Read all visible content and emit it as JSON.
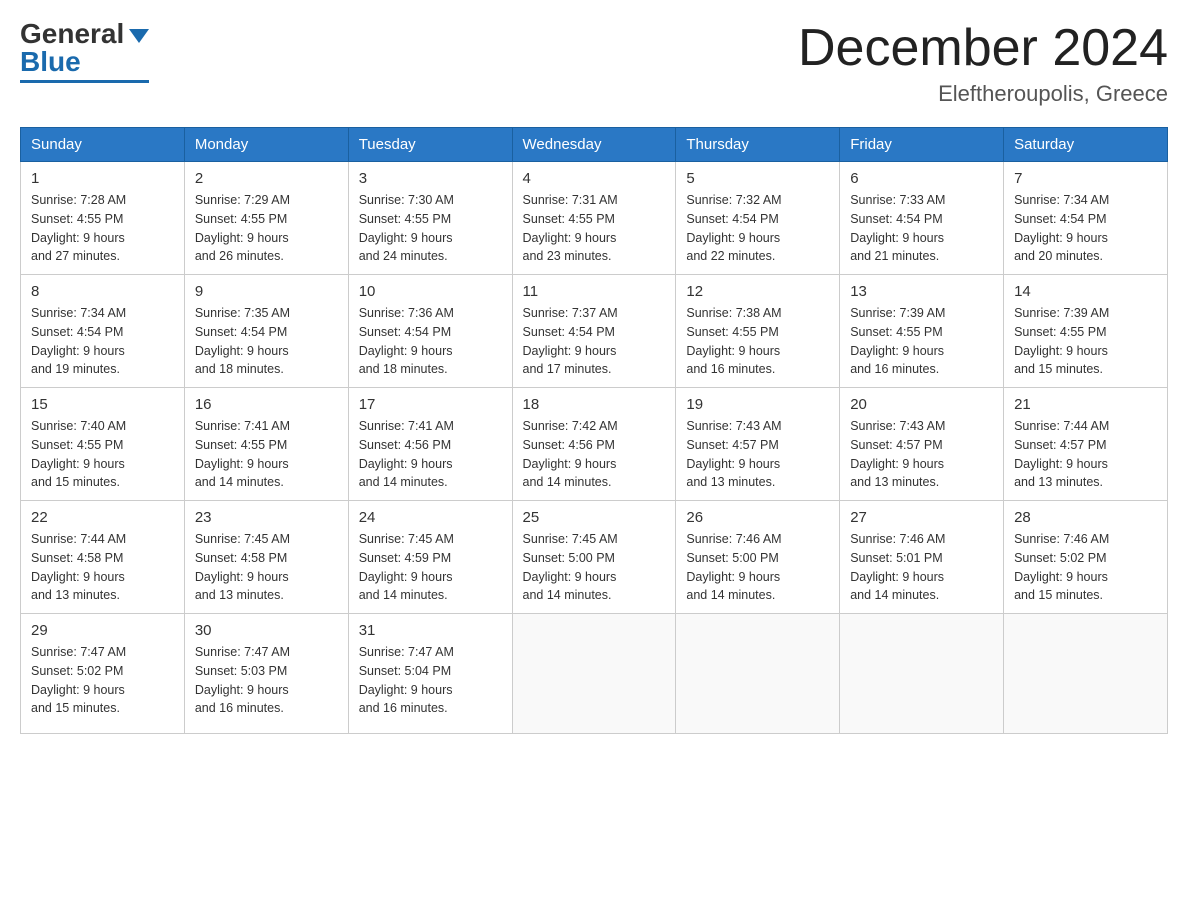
{
  "logo": {
    "general": "General",
    "blue": "Blue"
  },
  "title": "December 2024",
  "location": "Eleftheroupolis, Greece",
  "days_of_week": [
    "Sunday",
    "Monday",
    "Tuesday",
    "Wednesday",
    "Thursday",
    "Friday",
    "Saturday"
  ],
  "weeks": [
    [
      {
        "day": "1",
        "sunrise": "7:28 AM",
        "sunset": "4:55 PM",
        "daylight": "9 hours and 27 minutes."
      },
      {
        "day": "2",
        "sunrise": "7:29 AM",
        "sunset": "4:55 PM",
        "daylight": "9 hours and 26 minutes."
      },
      {
        "day": "3",
        "sunrise": "7:30 AM",
        "sunset": "4:55 PM",
        "daylight": "9 hours and 24 minutes."
      },
      {
        "day": "4",
        "sunrise": "7:31 AM",
        "sunset": "4:55 PM",
        "daylight": "9 hours and 23 minutes."
      },
      {
        "day": "5",
        "sunrise": "7:32 AM",
        "sunset": "4:54 PM",
        "daylight": "9 hours and 22 minutes."
      },
      {
        "day": "6",
        "sunrise": "7:33 AM",
        "sunset": "4:54 PM",
        "daylight": "9 hours and 21 minutes."
      },
      {
        "day": "7",
        "sunrise": "7:34 AM",
        "sunset": "4:54 PM",
        "daylight": "9 hours and 20 minutes."
      }
    ],
    [
      {
        "day": "8",
        "sunrise": "7:34 AM",
        "sunset": "4:54 PM",
        "daylight": "9 hours and 19 minutes."
      },
      {
        "day": "9",
        "sunrise": "7:35 AM",
        "sunset": "4:54 PM",
        "daylight": "9 hours and 18 minutes."
      },
      {
        "day": "10",
        "sunrise": "7:36 AM",
        "sunset": "4:54 PM",
        "daylight": "9 hours and 18 minutes."
      },
      {
        "day": "11",
        "sunrise": "7:37 AM",
        "sunset": "4:54 PM",
        "daylight": "9 hours and 17 minutes."
      },
      {
        "day": "12",
        "sunrise": "7:38 AM",
        "sunset": "4:55 PM",
        "daylight": "9 hours and 16 minutes."
      },
      {
        "day": "13",
        "sunrise": "7:39 AM",
        "sunset": "4:55 PM",
        "daylight": "9 hours and 16 minutes."
      },
      {
        "day": "14",
        "sunrise": "7:39 AM",
        "sunset": "4:55 PM",
        "daylight": "9 hours and 15 minutes."
      }
    ],
    [
      {
        "day": "15",
        "sunrise": "7:40 AM",
        "sunset": "4:55 PM",
        "daylight": "9 hours and 15 minutes."
      },
      {
        "day": "16",
        "sunrise": "7:41 AM",
        "sunset": "4:55 PM",
        "daylight": "9 hours and 14 minutes."
      },
      {
        "day": "17",
        "sunrise": "7:41 AM",
        "sunset": "4:56 PM",
        "daylight": "9 hours and 14 minutes."
      },
      {
        "day": "18",
        "sunrise": "7:42 AM",
        "sunset": "4:56 PM",
        "daylight": "9 hours and 14 minutes."
      },
      {
        "day": "19",
        "sunrise": "7:43 AM",
        "sunset": "4:57 PM",
        "daylight": "9 hours and 13 minutes."
      },
      {
        "day": "20",
        "sunrise": "7:43 AM",
        "sunset": "4:57 PM",
        "daylight": "9 hours and 13 minutes."
      },
      {
        "day": "21",
        "sunrise": "7:44 AM",
        "sunset": "4:57 PM",
        "daylight": "9 hours and 13 minutes."
      }
    ],
    [
      {
        "day": "22",
        "sunrise": "7:44 AM",
        "sunset": "4:58 PM",
        "daylight": "9 hours and 13 minutes."
      },
      {
        "day": "23",
        "sunrise": "7:45 AM",
        "sunset": "4:58 PM",
        "daylight": "9 hours and 13 minutes."
      },
      {
        "day": "24",
        "sunrise": "7:45 AM",
        "sunset": "4:59 PM",
        "daylight": "9 hours and 14 minutes."
      },
      {
        "day": "25",
        "sunrise": "7:45 AM",
        "sunset": "5:00 PM",
        "daylight": "9 hours and 14 minutes."
      },
      {
        "day": "26",
        "sunrise": "7:46 AM",
        "sunset": "5:00 PM",
        "daylight": "9 hours and 14 minutes."
      },
      {
        "day": "27",
        "sunrise": "7:46 AM",
        "sunset": "5:01 PM",
        "daylight": "9 hours and 14 minutes."
      },
      {
        "day": "28",
        "sunrise": "7:46 AM",
        "sunset": "5:02 PM",
        "daylight": "9 hours and 15 minutes."
      }
    ],
    [
      {
        "day": "29",
        "sunrise": "7:47 AM",
        "sunset": "5:02 PM",
        "daylight": "9 hours and 15 minutes."
      },
      {
        "day": "30",
        "sunrise": "7:47 AM",
        "sunset": "5:03 PM",
        "daylight": "9 hours and 16 minutes."
      },
      {
        "day": "31",
        "sunrise": "7:47 AM",
        "sunset": "5:04 PM",
        "daylight": "9 hours and 16 minutes."
      },
      null,
      null,
      null,
      null
    ]
  ]
}
